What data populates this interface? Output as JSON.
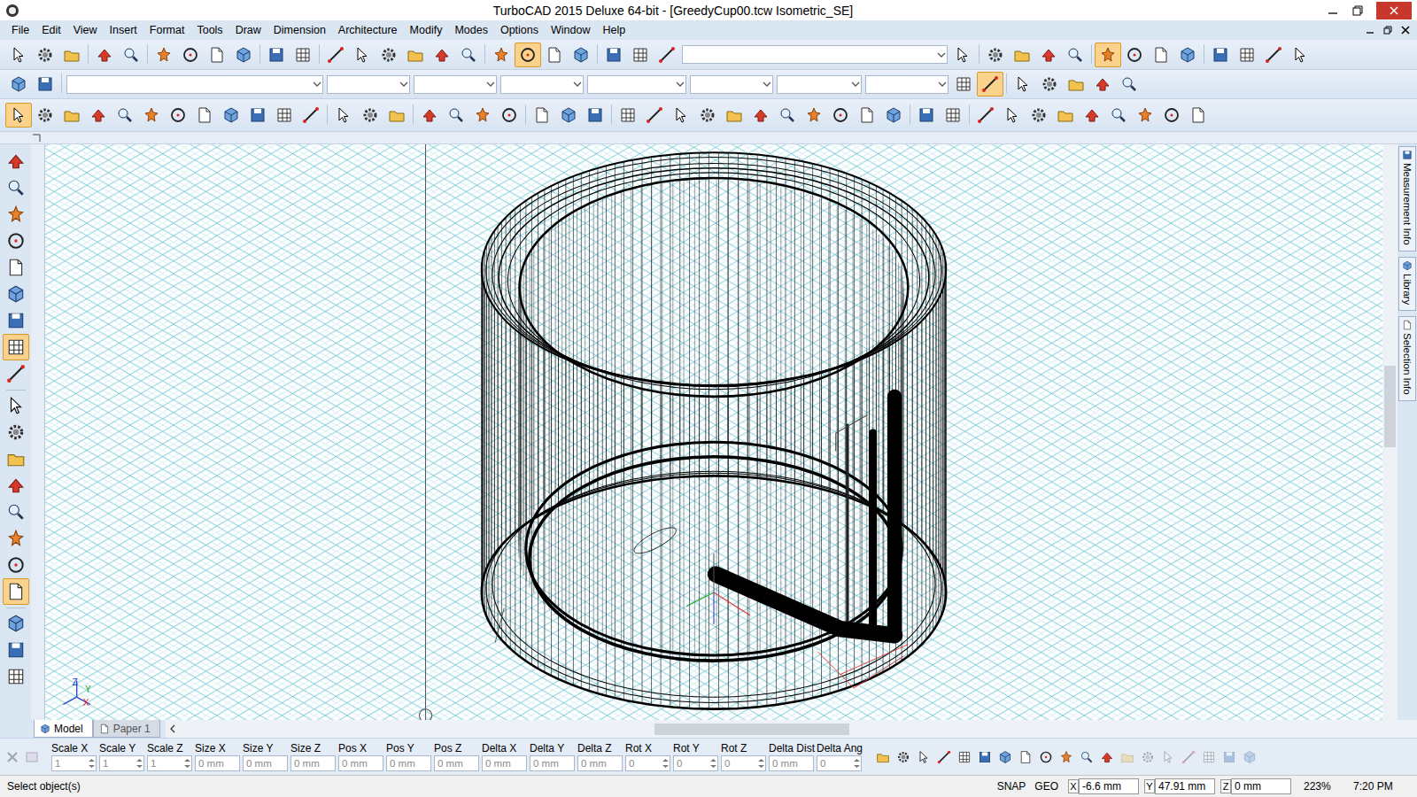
{
  "window": {
    "title": "TurboCAD 2015 Deluxe 64-bit - [GreedyCup00.tcw Isometric_SE]"
  },
  "menu": [
    "File",
    "Edit",
    "View",
    "Insert",
    "Format",
    "Tools",
    "Draw",
    "Dimension",
    "Architecture",
    "Modify",
    "Modes",
    "Options",
    "Window",
    "Help"
  ],
  "toolbars": [
    {
      "items": [
        {
          "kind": "button",
          "active": false
        },
        {
          "kind": "button",
          "active": false
        },
        {
          "kind": "button",
          "active": false
        },
        {
          "kind": "separator"
        },
        {
          "kind": "button",
          "active": false
        },
        {
          "kind": "button",
          "active": false
        },
        {
          "kind": "separator"
        },
        {
          "kind": "button",
          "active": false
        },
        {
          "kind": "button",
          "active": false
        },
        {
          "kind": "button",
          "active": false
        },
        {
          "kind": "button",
          "active": false
        },
        {
          "kind": "separator"
        },
        {
          "kind": "button",
          "active": false
        },
        {
          "kind": "button",
          "active": false
        },
        {
          "kind": "separator"
        },
        {
          "kind": "button",
          "active": false
        },
        {
          "kind": "button",
          "active": false
        },
        {
          "kind": "button",
          "active": false
        },
        {
          "kind": "button",
          "active": false
        },
        {
          "kind": "button",
          "active": false
        },
        {
          "kind": "button",
          "active": false
        },
        {
          "kind": "separator"
        },
        {
          "kind": "button",
          "active": false
        },
        {
          "kind": "button",
          "active": true
        },
        {
          "kind": "button",
          "active": false
        },
        {
          "kind": "button",
          "active": false
        },
        {
          "kind": "separator"
        },
        {
          "kind": "button",
          "active": false
        },
        {
          "kind": "button",
          "active": false
        },
        {
          "kind": "button",
          "active": false
        },
        {
          "kind": "field"
        },
        {
          "kind": "button",
          "active": false
        },
        {
          "kind": "separator"
        },
        {
          "kind": "button",
          "active": false
        },
        {
          "kind": "button",
          "active": false
        },
        {
          "kind": "button",
          "active": false
        },
        {
          "kind": "button",
          "active": false
        },
        {
          "kind": "separator"
        },
        {
          "kind": "button",
          "active": true
        },
        {
          "kind": "button",
          "active": false
        },
        {
          "kind": "button",
          "active": false
        },
        {
          "kind": "button",
          "active": false
        },
        {
          "kind": "separator"
        },
        {
          "kind": "button",
          "active": false
        },
        {
          "kind": "button",
          "active": false
        },
        {
          "kind": "button",
          "active": false
        },
        {
          "kind": "button",
          "active": false
        }
      ]
    },
    {
      "items": [
        {
          "kind": "button",
          "active": false
        },
        {
          "kind": "button",
          "active": false
        },
        {
          "kind": "separator"
        },
        {
          "kind": "field"
        },
        {
          "kind": "field"
        },
        {
          "kind": "field"
        },
        {
          "kind": "field"
        },
        {
          "kind": "field"
        },
        {
          "kind": "field"
        },
        {
          "kind": "field"
        },
        {
          "kind": "field"
        },
        {
          "kind": "button",
          "active": false
        },
        {
          "kind": "button",
          "active": true
        },
        {
          "kind": "separator"
        },
        {
          "kind": "button",
          "active": false
        },
        {
          "kind": "button",
          "active": false
        },
        {
          "kind": "button",
          "active": false
        },
        {
          "kind": "button",
          "active": false
        },
        {
          "kind": "button",
          "active": false
        }
      ]
    },
    {
      "items": [
        {
          "kind": "button",
          "active": true
        },
        {
          "kind": "button",
          "active": false
        },
        {
          "kind": "button",
          "active": false
        },
        {
          "kind": "button",
          "active": false
        },
        {
          "kind": "button",
          "active": false
        },
        {
          "kind": "button",
          "active": false
        },
        {
          "kind": "button",
          "active": false
        },
        {
          "kind": "button",
          "active": false
        },
        {
          "kind": "button",
          "active": false
        },
        {
          "kind": "button",
          "active": false
        },
        {
          "kind": "button",
          "active": false
        },
        {
          "kind": "button",
          "active": false
        },
        {
          "kind": "separator"
        },
        {
          "kind": "button",
          "active": false
        },
        {
          "kind": "button",
          "active": false
        },
        {
          "kind": "button",
          "active": false
        },
        {
          "kind": "separator"
        },
        {
          "kind": "button",
          "active": false
        },
        {
          "kind": "button",
          "active": false
        },
        {
          "kind": "button",
          "active": false
        },
        {
          "kind": "button",
          "active": false
        },
        {
          "kind": "separator"
        },
        {
          "kind": "button",
          "active": false
        },
        {
          "kind": "button",
          "active": false
        },
        {
          "kind": "button",
          "active": false
        },
        {
          "kind": "separator"
        },
        {
          "kind": "button",
          "active": false
        },
        {
          "kind": "button",
          "active": false
        },
        {
          "kind": "button",
          "active": false
        },
        {
          "kind": "button",
          "active": false
        },
        {
          "kind": "button",
          "active": false
        },
        {
          "kind": "button",
          "active": false
        },
        {
          "kind": "button",
          "active": false
        },
        {
          "kind": "button",
          "active": false
        },
        {
          "kind": "button",
          "active": false
        },
        {
          "kind": "button",
          "active": false
        },
        {
          "kind": "button",
          "active": false
        },
        {
          "kind": "separator"
        },
        {
          "kind": "button",
          "active": false
        },
        {
          "kind": "button",
          "active": false
        },
        {
          "kind": "separator"
        },
        {
          "kind": "button",
          "active": false
        },
        {
          "kind": "button",
          "active": false
        },
        {
          "kind": "button",
          "active": false
        },
        {
          "kind": "button",
          "active": false
        },
        {
          "kind": "button",
          "active": false
        },
        {
          "kind": "button",
          "active": false
        },
        {
          "kind": "button",
          "active": false
        },
        {
          "kind": "button",
          "active": false
        },
        {
          "kind": "button",
          "active": false
        }
      ]
    },
    {
      "items": [
        {
          "kind": "button",
          "active": false
        },
        {
          "kind": "button",
          "active": false
        },
        {
          "kind": "button",
          "active": false
        },
        {
          "kind": "button",
          "active": false
        },
        {
          "kind": "button",
          "active": false
        },
        {
          "kind": "button",
          "active": false
        },
        {
          "kind": "button",
          "active": false
        },
        {
          "kind": "button",
          "active": true
        },
        {
          "kind": "button",
          "active": false
        },
        {
          "kind": "separator"
        },
        {
          "kind": "button",
          "active": false
        },
        {
          "kind": "button",
          "active": false
        },
        {
          "kind": "button",
          "active": false
        },
        {
          "kind": "button",
          "active": false
        },
        {
          "kind": "button",
          "active": false
        },
        {
          "kind": "button",
          "active": false
        },
        {
          "kind": "button",
          "active": false
        },
        {
          "kind": "button",
          "active": true
        },
        {
          "kind": "separator"
        },
        {
          "kind": "button",
          "active": false
        },
        {
          "kind": "button",
          "active": false
        },
        {
          "kind": "button",
          "active": false
        }
      ]
    }
  ],
  "side_tabs": [
    {
      "label": "Measurement Info"
    },
    {
      "label": "Library"
    },
    {
      "label": "Selection Info"
    }
  ],
  "ucs_axes": [
    "Z",
    "Y",
    "X"
  ],
  "drawing_tabs": [
    {
      "label": "Model",
      "selected": true
    },
    {
      "label": "Paper 1",
      "selected": false
    }
  ],
  "inspector": {
    "fields": [
      {
        "label": "Scale X",
        "value": "1",
        "kind": "spin",
        "disabled": true
      },
      {
        "label": "Scale Y",
        "value": "1",
        "kind": "spin",
        "disabled": true
      },
      {
        "label": "Scale Z",
        "value": "1",
        "kind": "spin",
        "disabled": true
      },
      {
        "label": "Size X",
        "value": "0 mm",
        "kind": "text",
        "disabled": true
      },
      {
        "label": "Size Y",
        "value": "0 mm",
        "kind": "text",
        "disabled": true
      },
      {
        "label": "Size Z",
        "value": "0 mm",
        "kind": "text",
        "disabled": true
      },
      {
        "label": "Pos X",
        "value": "0 mm",
        "kind": "text",
        "disabled": true
      },
      {
        "label": "Pos Y",
        "value": "0 mm",
        "kind": "text",
        "disabled": true
      },
      {
        "label": "Pos Z",
        "value": "0 mm",
        "kind": "text",
        "disabled": true
      },
      {
        "label": "Delta X",
        "value": "0 mm",
        "kind": "text",
        "disabled": true
      },
      {
        "label": "Delta Y",
        "value": "0 mm",
        "kind": "text",
        "disabled": true
      },
      {
        "label": "Delta Z",
        "value": "0 mm",
        "kind": "text",
        "disabled": true
      },
      {
        "label": "Rot X",
        "value": "0",
        "kind": "spin",
        "disabled": true
      },
      {
        "label": "Rot Y",
        "value": "0",
        "kind": "spin",
        "disabled": true
      },
      {
        "label": "Rot Z",
        "value": "0",
        "kind": "spin",
        "disabled": true
      },
      {
        "label": "Delta Dist",
        "value": "0 mm",
        "kind": "text",
        "disabled": true
      },
      {
        "label": "Delta Ang",
        "value": "0",
        "kind": "spin",
        "disabled": true
      }
    ],
    "tools": [
      {
        "disabled": false
      },
      {
        "disabled": false
      },
      {
        "disabled": false
      },
      {
        "disabled": false
      },
      {
        "disabled": false
      },
      {
        "disabled": false
      },
      {
        "disabled": false
      },
      {
        "disabled": false
      },
      {
        "disabled": false
      },
      {
        "disabled": false
      },
      {
        "disabled": false
      },
      {
        "disabled": false
      },
      {
        "disabled": true
      },
      {
        "disabled": true
      },
      {
        "disabled": true
      },
      {
        "disabled": true
      },
      {
        "disabled": true
      },
      {
        "disabled": true
      },
      {
        "disabled": true
      }
    ]
  },
  "status_bar": {
    "message": "Select object(s)",
    "modes": [
      "SNAP",
      "GEO"
    ],
    "coords": [
      {
        "axis": "X",
        "value": "-6.6 mm"
      },
      {
        "axis": "Y",
        "value": "47.91 mm"
      },
      {
        "axis": "Z",
        "value": "0 mm"
      }
    ],
    "zoom": "223%",
    "time": "7:20 PM"
  }
}
